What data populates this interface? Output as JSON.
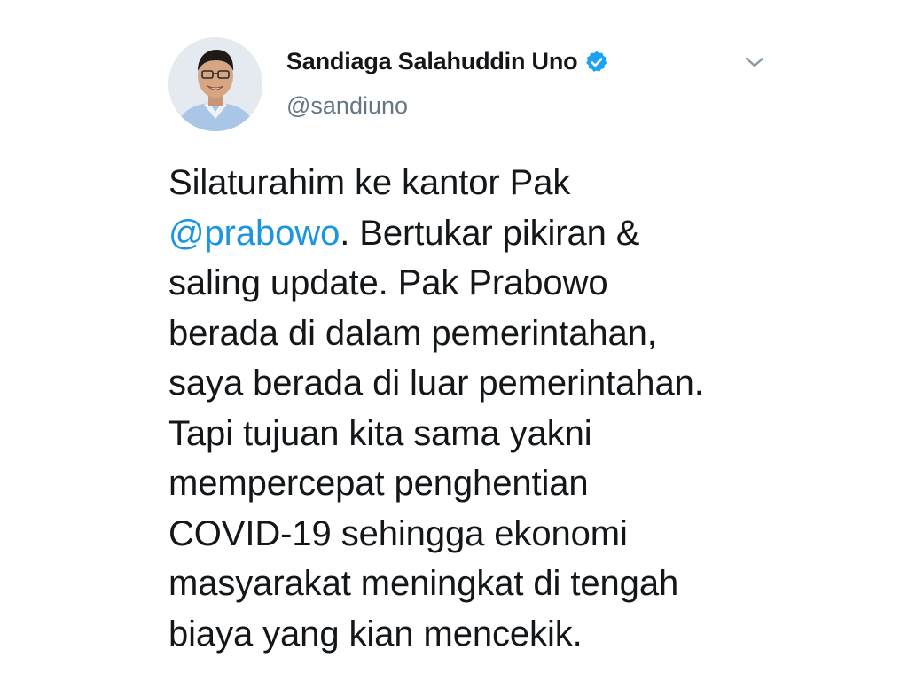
{
  "user": {
    "display_name": "Sandiaga Salahuddin Uno",
    "handle": "@sandiuno",
    "verified": true
  },
  "tweet": {
    "lines": [
      "Silaturahim ke kantor Pak",
      "Bertukar pikiran &",
      "saling update. Pak Prabowo",
      "berada di dalam pemerintahan,",
      "saya berada di luar pemerintahan.",
      "Tapi tujuan kita sama yakni",
      "mempercepat penghentian",
      "COVID-19 sehingga ekonomi",
      "masyarakat meningkat di tengah",
      "biaya yang kian mencekik."
    ],
    "mention": "@prabowo",
    "mention_suffix": "."
  },
  "icons": {
    "verified": "verified-badge-icon",
    "menu": "chevron-down-icon",
    "avatar": "profile-photo"
  },
  "colors": {
    "text": "#14171a",
    "secondary": "#657786",
    "link": "#1b95e0",
    "verified": "#1da1f2"
  }
}
